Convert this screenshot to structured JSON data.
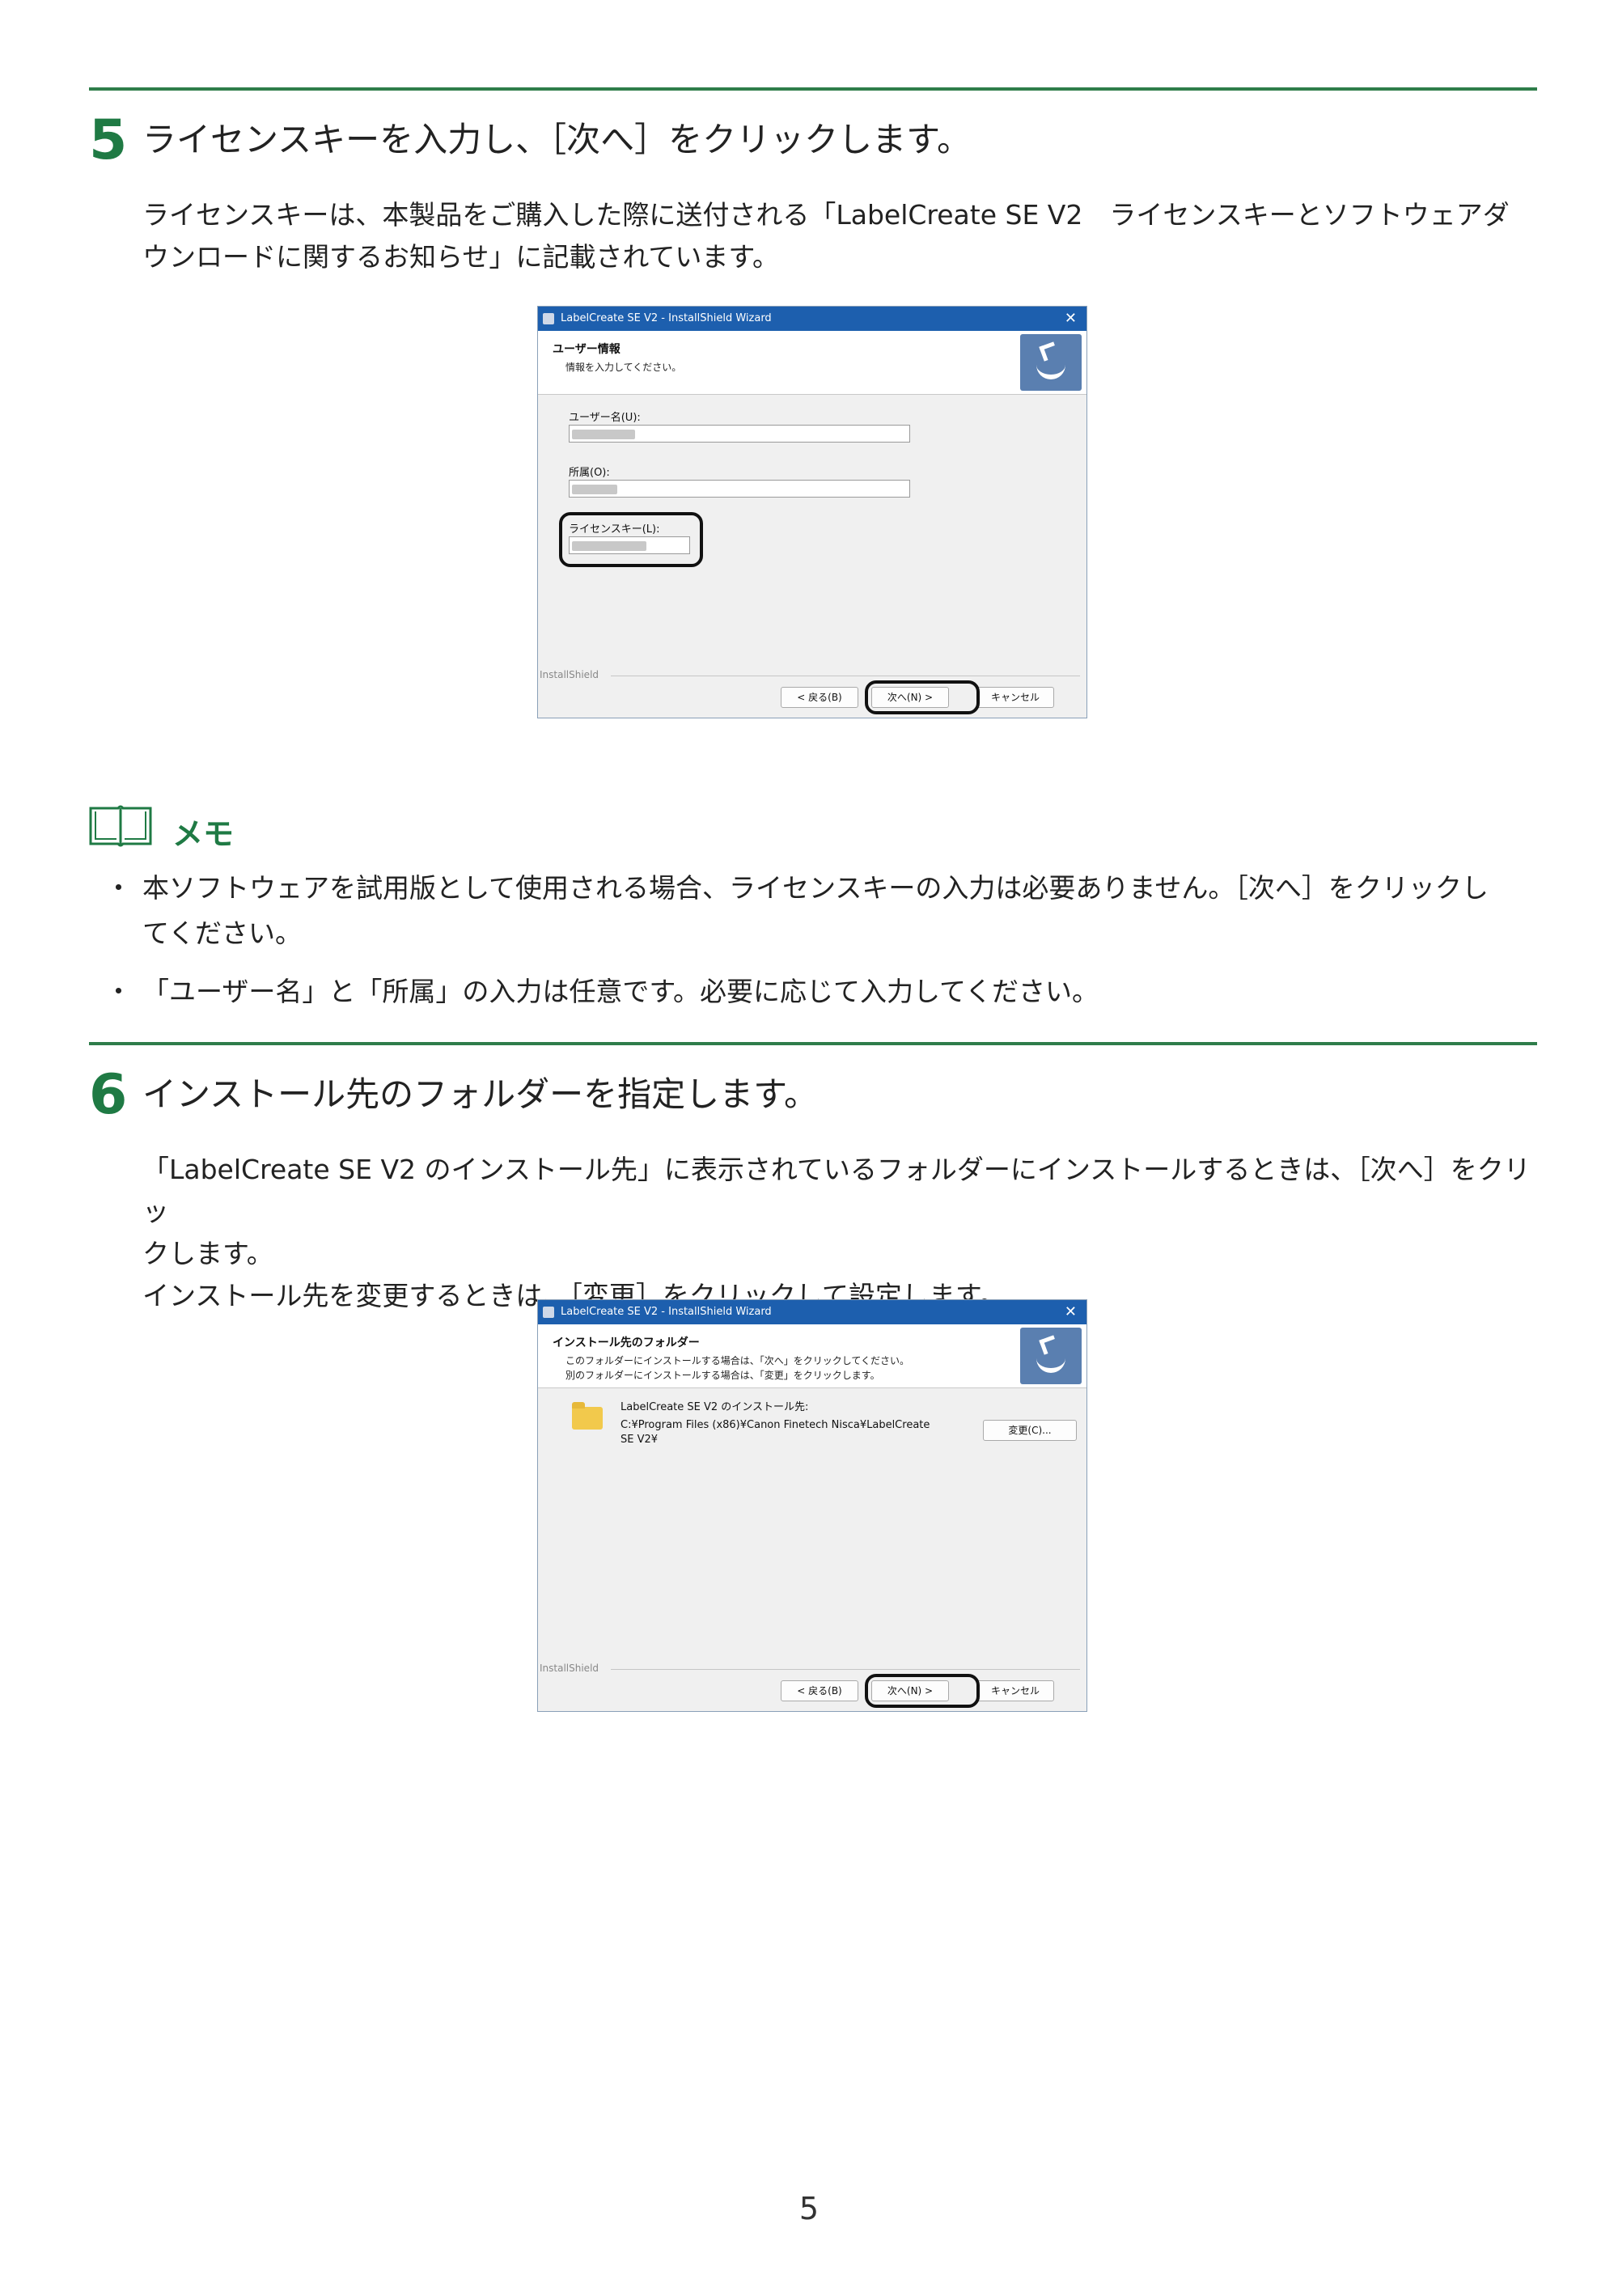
{
  "step5": {
    "number": "5",
    "heading": "ライセンスキーを入力し、［次へ］をクリックします。",
    "body_line1": "ライセンスキーは、本製品をご購入した際に送付される「LabelCreate SE V2　ライセンスキーとソフトウェアダ",
    "body_line2": "ウンロードに関するお知らせ」に記載されています。"
  },
  "dialog1": {
    "title": "LabelCreate SE V2 - InstallShield Wizard",
    "close": "✕",
    "banner_title": "ユーザー情報",
    "banner_subtitle": "情報を入力してください。",
    "user_label": "ユーザー名(U):",
    "org_label": "所属(O):",
    "license_label": "ライセンスキー(L):",
    "brand": "InstallShield",
    "back_button": "< 戻る(B)",
    "next_button": "次へ(N) >",
    "cancel_button": "キャンセル"
  },
  "memo": {
    "title": "メモ",
    "bullet": "・",
    "item1_line1": "本ソフトウェアを試用版として使用される場合、ライセンスキーの入力は必要ありません。［次へ］をクリックし",
    "item1_line2": "てください。",
    "item2": "「ユーザー名」と「所属」の入力は任意です。必要に応じて入力してください。"
  },
  "step6": {
    "number": "6",
    "heading": "インストール先のフォルダーを指定します。",
    "body_line1": "「LabelCreate SE V2 のインストール先」に表示されているフォルダーにインストールするときは、［次へ］をクリッ",
    "body_line2": "クします。",
    "body_line3": "インストール先を変更するときは、［変更］をクリックして設定します。"
  },
  "dialog2": {
    "title": "LabelCreate SE V2 - InstallShield Wizard",
    "close": "✕",
    "banner_title": "インストール先のフォルダー",
    "banner_line1": "このフォルダーにインストールする場合は、「次へ」をクリックしてください。",
    "banner_line2": "別のフォルダーにインストールする場合は、「変更」をクリックします。",
    "dest_label": "LabelCreate SE V2 のインストール先:",
    "dest_path1": "C:¥Program Files (x86)¥Canon Finetech Nisca¥LabelCreate",
    "dest_path2": "SE V2¥",
    "change_button": "変更(C)...",
    "brand": "InstallShield",
    "back_button": "< 戻る(B)",
    "next_button": "次へ(N) >",
    "cancel_button": "キャンセル"
  },
  "page_number": "5",
  "colors": {
    "accent": "#1f7a44",
    "rule": "#2e7d4a",
    "titlebar": "#1d5fae"
  }
}
